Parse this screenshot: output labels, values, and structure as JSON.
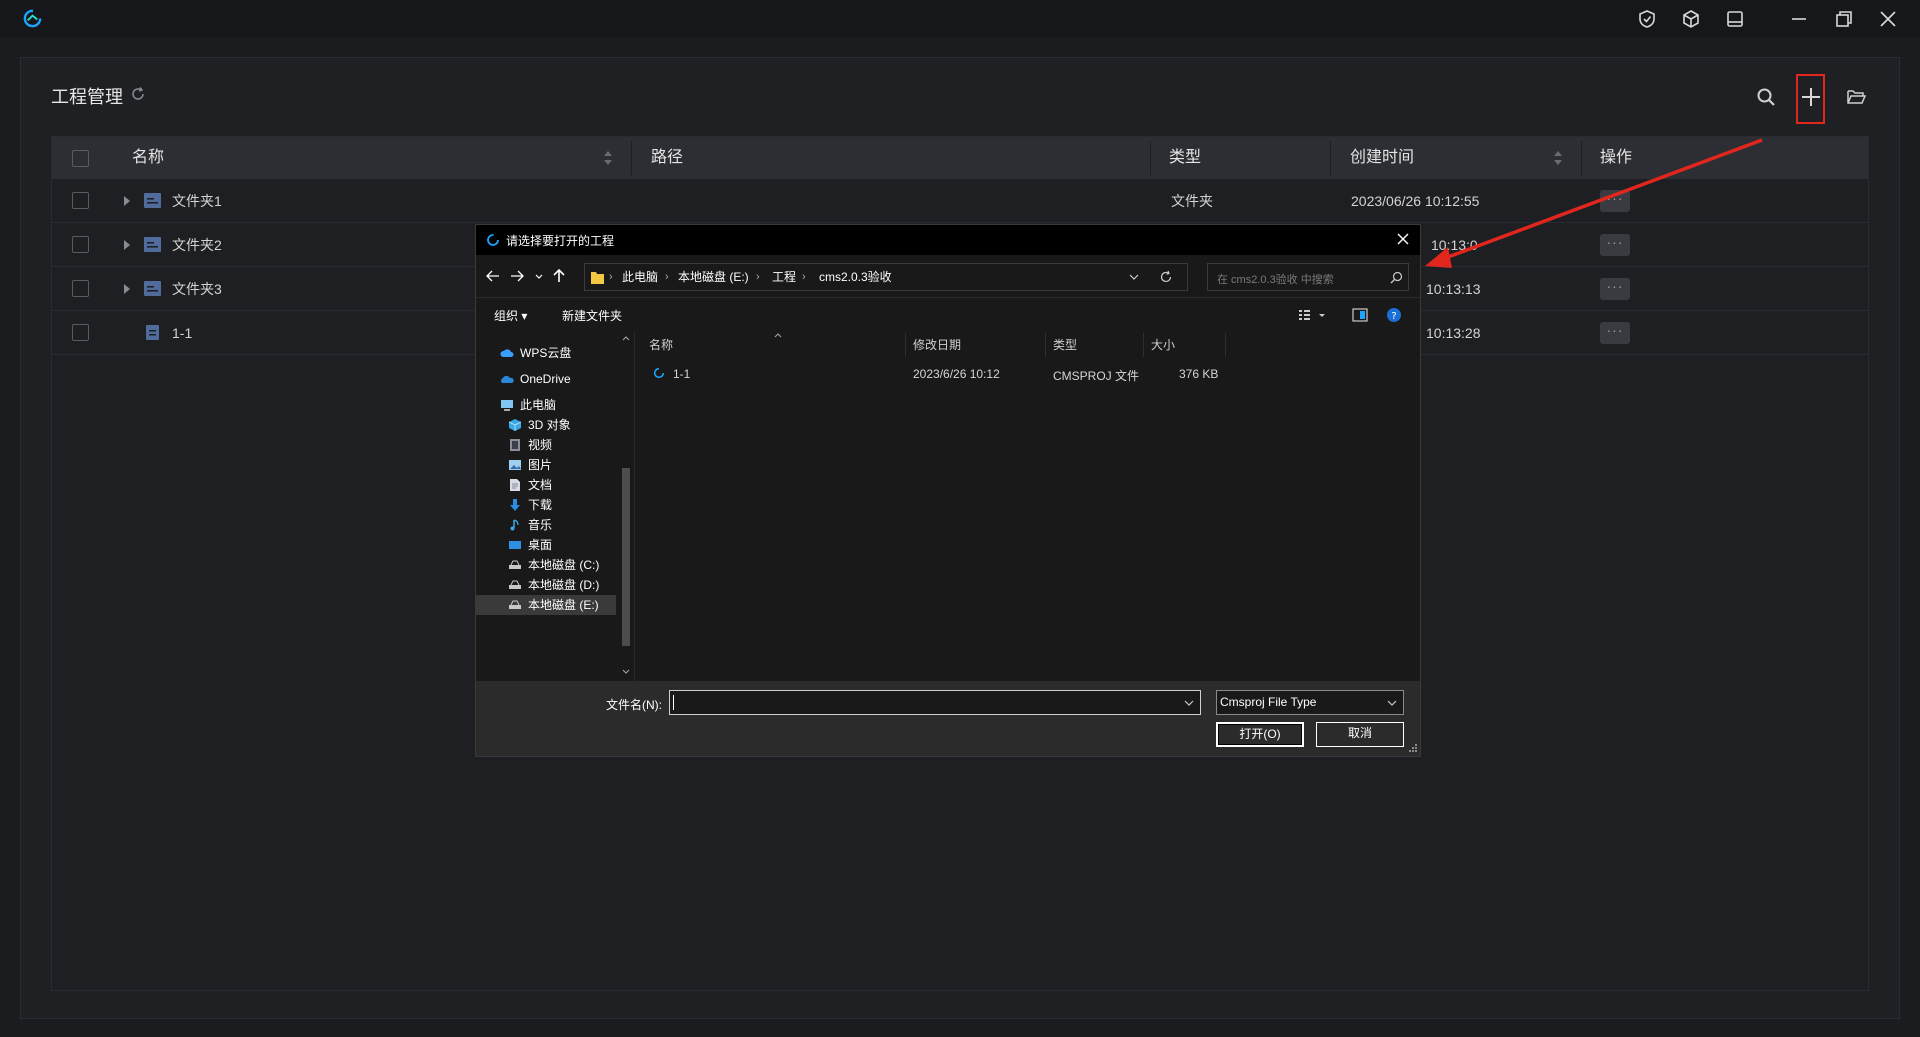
{
  "app": {
    "section_title": "工程管理"
  },
  "table": {
    "headers": {
      "name": "名称",
      "path": "路径",
      "type": "类型",
      "created": "创建时间",
      "actions": "操作"
    },
    "rows": [
      {
        "name": "文件夹1",
        "type": "文件夹",
        "created": "2023/06/26 10:12:55",
        "kind": "folder"
      },
      {
        "name": "文件夹2",
        "type": "",
        "created": "10:13:0",
        "kind": "folder"
      },
      {
        "name": "文件夹3",
        "type": "",
        "created": "10:13:13",
        "kind": "folder"
      },
      {
        "name": "1-1",
        "type": "",
        "created": "10:13:28",
        "kind": "file"
      }
    ],
    "more_label": "···"
  },
  "dialog": {
    "title": "请选择要打开的工程",
    "address": [
      "此电脑",
      "本地磁盘 (E:)",
      "工程",
      "cms2.0.3验收"
    ],
    "search_placeholder": "在 cms2.0.3验收 中搜索",
    "organize": "组织 ▾",
    "new_folder": "新建文件夹",
    "nav_items": [
      {
        "label": "WPS云盘",
        "icon": "cloud-icon"
      },
      {
        "label": "OneDrive",
        "icon": "cloud-icon"
      },
      {
        "label": "此电脑",
        "icon": "computer-icon"
      },
      {
        "label": "3D 对象",
        "icon": "cube-icon"
      },
      {
        "label": "视频",
        "icon": "video-icon"
      },
      {
        "label": "图片",
        "icon": "picture-icon"
      },
      {
        "label": "文档",
        "icon": "document-icon"
      },
      {
        "label": "下载",
        "icon": "download-icon"
      },
      {
        "label": "音乐",
        "icon": "music-icon"
      },
      {
        "label": "桌面",
        "icon": "desktop-icon"
      },
      {
        "label": "本地磁盘 (C:)",
        "icon": "drive-icon"
      },
      {
        "label": "本地磁盘 (D:)",
        "icon": "drive-icon"
      },
      {
        "label": "本地磁盘 (E:)",
        "icon": "drive-icon"
      }
    ],
    "columns": {
      "name": "名称",
      "modified": "修改日期",
      "type": "类型",
      "size": "大小"
    },
    "files": [
      {
        "name": "1-1",
        "modified": "2023/6/26 10:12",
        "type": "CMSPROJ 文件",
        "size": "376 KB"
      }
    ],
    "filename_label": "文件名(N):",
    "filename_value": "",
    "filetype": "Cmsproj File Type",
    "open_button": "打开(O)",
    "cancel_button": "取消"
  },
  "colors": {
    "accent_blue": "#1aa3ff",
    "highlight_red": "#e0261d"
  }
}
